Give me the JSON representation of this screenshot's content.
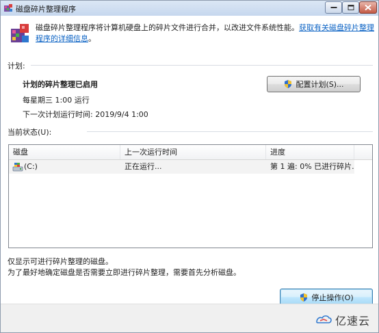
{
  "window": {
    "title": "磁盘碎片整理程序"
  },
  "header": {
    "description": "磁盘碎片整理程序将计算机硬盘上的碎片文件进行合并，以改进文件系统性能。",
    "link_text": "获取有关磁盘碎片整理程序的详细信息",
    "link_end": "。"
  },
  "schedule": {
    "section_label": "计划:",
    "status": "计划的碎片整理已启用",
    "frequency": "每星期三  1:00 运行",
    "next_run": "下一次计划运行时间: 2019/9/4 1:00",
    "configure_button": "配置计划(S)..."
  },
  "current_status": {
    "section_label": "当前状态(U):",
    "columns": [
      "磁盘",
      "上一次运行时间",
      "进度"
    ],
    "rows": [
      {
        "disk": "(C:)",
        "last_run": "正在运行...",
        "progress": "第 1 遍: 0% 已进行碎片..."
      }
    ]
  },
  "notes": {
    "line1": "仅显示可进行碎片整理的磁盘。",
    "line2": "为了最好地确定磁盘是否需要立即进行碎片整理，需要首先分析磁盘。"
  },
  "actions": {
    "stop_button": "停止操作(O)"
  },
  "watermark": {
    "text": "亿速云"
  }
}
